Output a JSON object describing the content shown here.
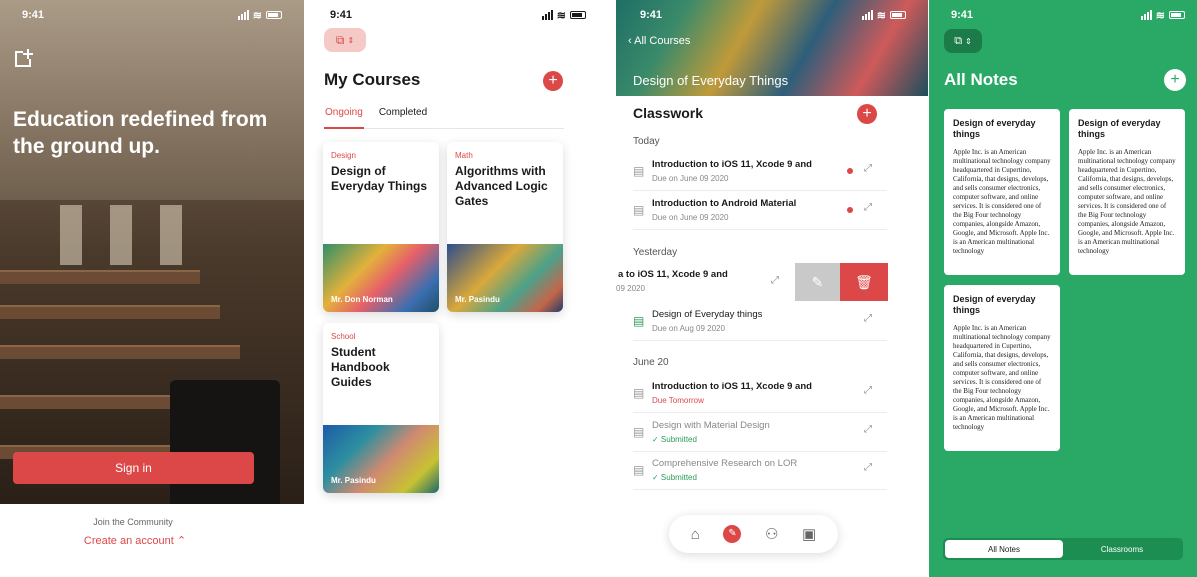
{
  "status": {
    "time": "9:41"
  },
  "welcome": {
    "logo_icon": "add-tab-logo-icon",
    "headline": "Education redefined from the ground up.",
    "signin_label": "Sign in",
    "join_text": "Join the Community",
    "create_account_label": "Create an account ⌃"
  },
  "courses": {
    "title": "My Courses",
    "tabs": [
      {
        "label": "Ongoing",
        "active": true
      },
      {
        "label": "Completed",
        "active": false
      }
    ],
    "cards": [
      {
        "category": "Design",
        "title": "Design of Everyday Things",
        "teacher": "Mr. Don Norman"
      },
      {
        "category": "Math",
        "title": "Algorithms with Advanced Logic Gates",
        "teacher": "Mr. Pasindu"
      },
      {
        "category": "School",
        "title": "Student Handbook Guides",
        "teacher": "Mr. Pasindu"
      }
    ]
  },
  "classwork": {
    "back_label": "All Courses",
    "course_title": "Design of Everyday Things",
    "title": "Classwork",
    "sections": {
      "today": "Today",
      "yesterday": "Yesterday",
      "june20": "June 20"
    },
    "today_items": [
      {
        "title": "Introduction to iOS 11, Xcode 9 and",
        "date": "Due on June 09 2020"
      },
      {
        "title": "Introduction to Android Material",
        "date": "Due on June 09 2020"
      }
    ],
    "swiped_item": {
      "title": "a to iOS 11, Xcode 9 and",
      "date": "09 2020"
    },
    "yesterday_item": {
      "title": "Design of Everyday things",
      "date": "Due on Aug 09 2020"
    },
    "june_items": [
      {
        "title": "Introduction to iOS 11, Xcode 9 and",
        "date": "Due Tomorrow"
      },
      {
        "title": "Design with Material Design",
        "date": "✓ Submitted"
      },
      {
        "title": "Comprehensive Research on LOR",
        "date": "✓ Submitted"
      }
    ],
    "nav_icons": [
      "home-icon",
      "compass-icon",
      "people-icon",
      "book-icon"
    ]
  },
  "notes": {
    "title": "All Notes",
    "items": [
      {
        "title": "Design of everyday things",
        "body": "Apple Inc. is an American multinational technology company headquartered in Cupertino, California, that designs, develops, and sells consumer electronics, computer software, and online services. It is considered one of the Big Four technology companies, alongside Amazon, Google, and Microsoft. Apple Inc. is an American multinational technology"
      },
      {
        "title": "Design of everyday things",
        "body": "Apple Inc. is an American multinational technology company headquartered in Cupertino, California, that designs, develops, and sells consumer electronics, computer software, and online services. It is considered one of the Big Four technology companies, alongside Amazon, Google, and Microsoft. Apple Inc. is an American multinational technology"
      },
      {
        "title": "Design of everyday things",
        "body": "Apple Inc. is an American multinational technology company headquartered in Cupertino, California, that designs, develops, and sells consumer electronics, computer software, and online services. It is considered one of the Big Four technology companies, alongside Amazon, Google, and Microsoft. Apple Inc. is an American multinational technology"
      }
    ],
    "segments": [
      {
        "label": "All Notes",
        "active": true
      },
      {
        "label": "Classrooms",
        "active": false
      }
    ]
  },
  "colors": {
    "accent_red": "#dc4847",
    "accent_green": "#2aa865"
  }
}
